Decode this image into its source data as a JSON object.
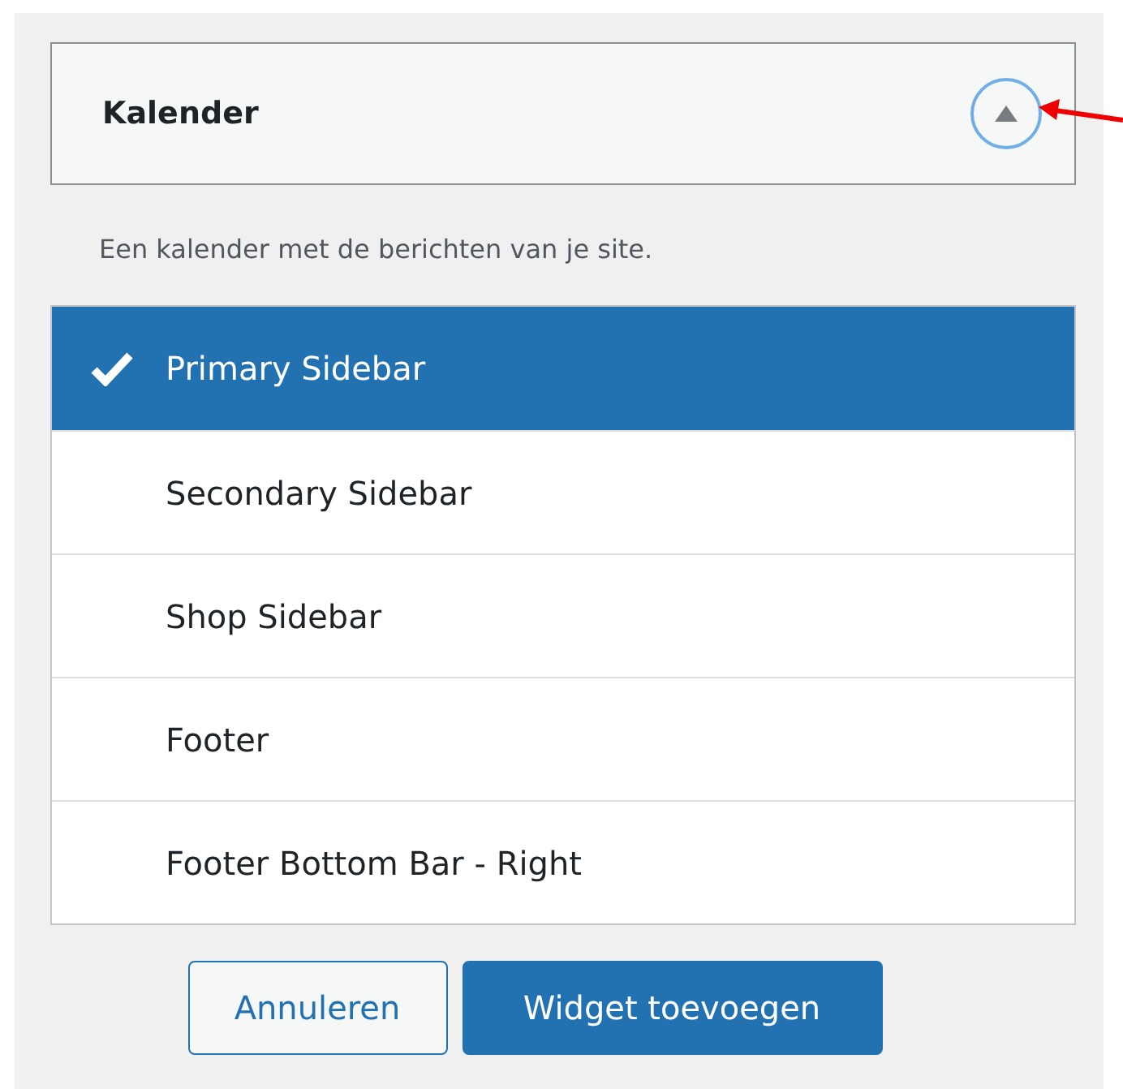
{
  "widget": {
    "title": "Kalender",
    "expanded": true
  },
  "description": "Een kalender met de berichten van je site.",
  "areas": [
    {
      "label": "Primary Sidebar",
      "selected": true
    },
    {
      "label": "Secondary Sidebar",
      "selected": false
    },
    {
      "label": "Shop Sidebar",
      "selected": false
    },
    {
      "label": "Footer",
      "selected": false
    },
    {
      "label": "Footer Bottom Bar - Right",
      "selected": false
    }
  ],
  "buttons": [
    {
      "label": "Annuleren",
      "kind": "secondary"
    },
    {
      "label": "Widget toevoegen",
      "kind": "primary"
    }
  ]
}
